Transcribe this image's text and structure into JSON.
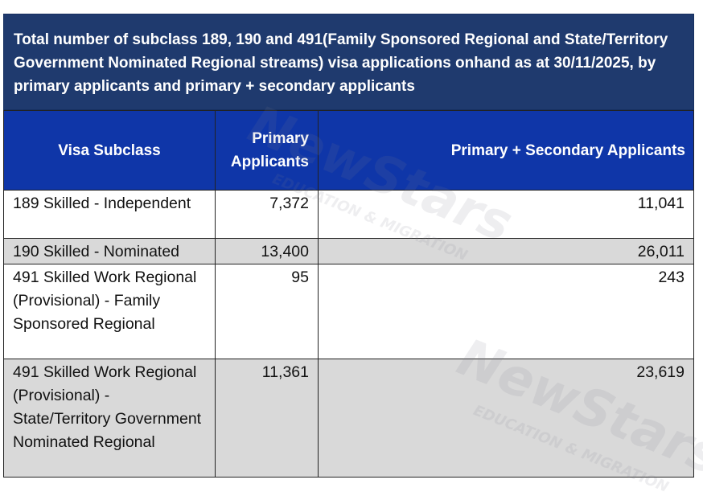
{
  "title": "Total number of subclass 189, 190 and 491(Family Sponsored Regional and State/Territory Government Nominated Regional streams) visa applications onhand as at 30/11/2025, by primary applicants and primary + secondary applicants",
  "columns": {
    "subclass": "Visa Subclass",
    "primary": "Primary Applicants",
    "primary_secondary": "Primary + Secondary Applicants"
  },
  "rows": [
    {
      "subclass": "189 Skilled - Independent",
      "primary": "7,372",
      "primary_secondary": "11,041"
    },
    {
      "subclass": "190 Skilled - Nominated",
      "primary": "13,400",
      "primary_secondary": "26,011"
    },
    {
      "subclass": "491 Skilled Work Regional (Provisional) - Family Sponsored Regional",
      "primary": "95",
      "primary_secondary": "243"
    },
    {
      "subclass": "491 Skilled Work Regional (Provisional) - State/Territory Government Nominated Regional",
      "primary": "11,361",
      "primary_secondary": "23,619"
    }
  ],
  "watermark": {
    "brand": "NewStars",
    "tagline": "EDUCATION & MIGRATION"
  },
  "colors": {
    "title_bg": "#1f3a6e",
    "header_bg": "#0f36a8",
    "shade_row": "#d9d9d9"
  }
}
